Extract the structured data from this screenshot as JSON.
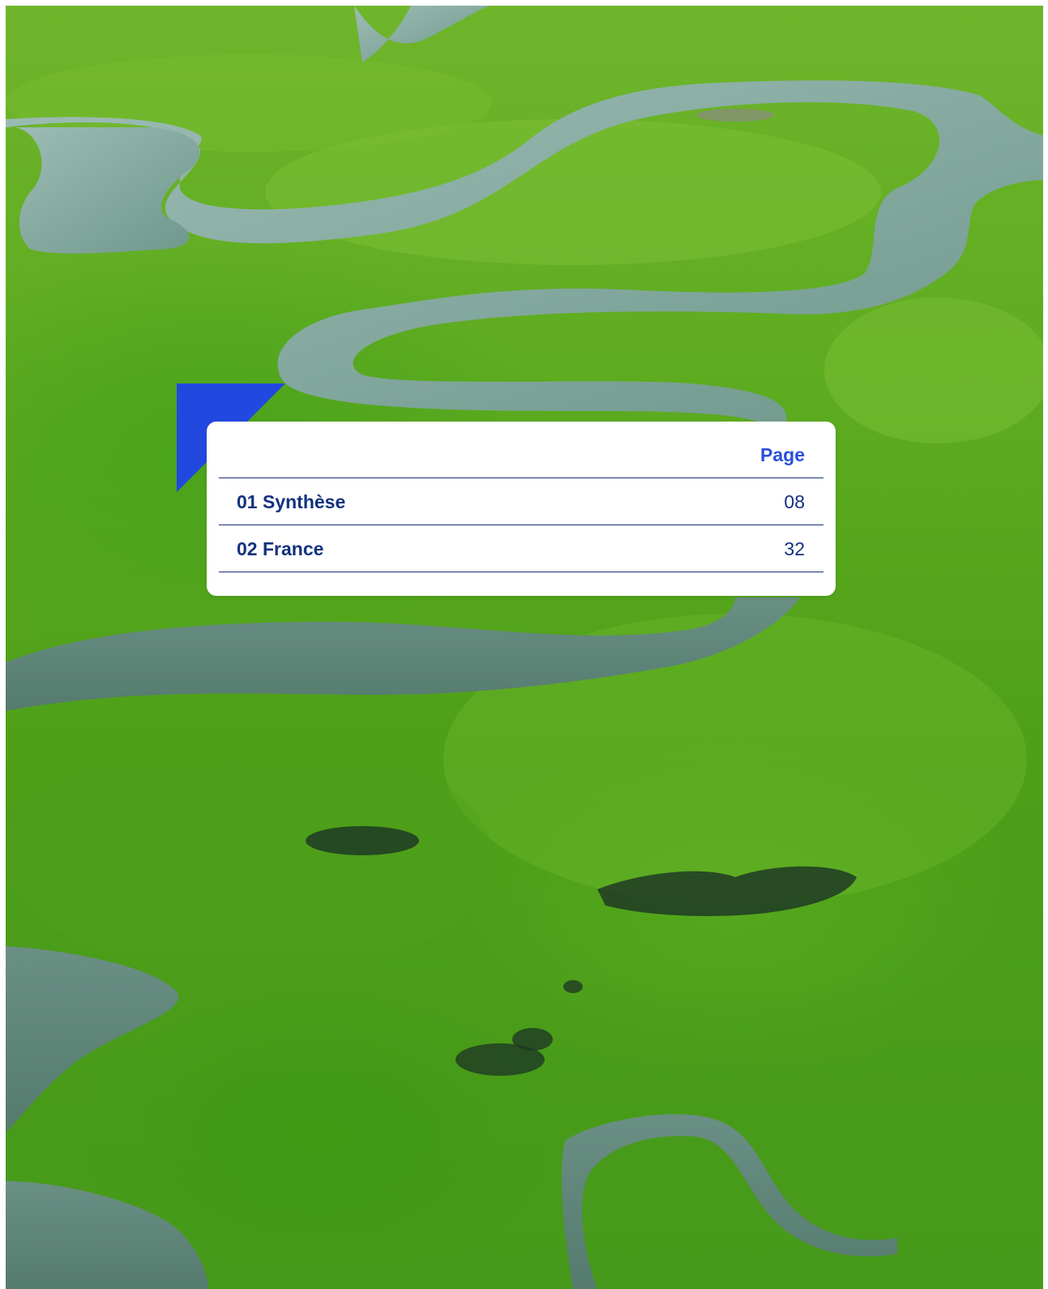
{
  "toc": {
    "header_label": "Page",
    "entries": [
      {
        "title": "01 Synthèse",
        "page": "08"
      },
      {
        "title": "02 France",
        "page": "32"
      }
    ]
  },
  "colors": {
    "accent": "#2a4fd8",
    "text_dark_blue": "#12327f",
    "rule": "#1a2f7a",
    "forest_green": "#5aa620",
    "river": "#7ea7a0"
  },
  "background": {
    "icon": "aerial-river-forest-photo"
  }
}
